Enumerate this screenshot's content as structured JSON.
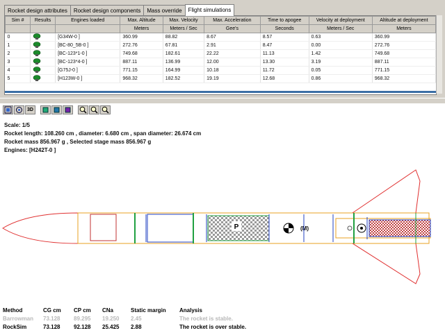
{
  "tabs": [
    {
      "label": "Rocket design attributes",
      "active": false
    },
    {
      "label": "Rocket design components",
      "active": false
    },
    {
      "label": "Mass override",
      "active": false
    },
    {
      "label": "Flight simulations",
      "active": true
    }
  ],
  "table": {
    "headers": [
      "Sim #",
      "Results",
      "Engines loaded",
      "Max. Altitude",
      "Max. Velocity",
      "Max. Acceleration",
      "Time to apogee",
      "Velocity at deployment",
      "Altitude at deployment"
    ],
    "units": [
      "",
      "",
      "",
      "Meters",
      "Meters / Sec",
      "Gee's",
      "Seconds",
      "Meters / Sec",
      "Meters"
    ],
    "rows": [
      [
        "0",
        "",
        "[G34W-0 ]",
        "360.99",
        "88.82",
        "8.67",
        "8.57",
        "0.63",
        "360.99"
      ],
      [
        "1",
        "",
        "[BC-80_5B-0 ]",
        "272.76",
        "67.81",
        "2.91",
        "8.47",
        "0.00",
        "272.76"
      ],
      [
        "2",
        "",
        "[BC-123*1-0 ]",
        "749.68",
        "182.61",
        "22.22",
        "11.13",
        "1.42",
        "749.68"
      ],
      [
        "3",
        "",
        "[BC-123*4-0 ]",
        "887.11",
        "136.99",
        "12.00",
        "13.30",
        "3.19",
        "887.11"
      ],
      [
        "4",
        "",
        "[G75J-0 ]",
        "771.15",
        "164.99",
        "10.18",
        "11.72",
        "0.05",
        "771.15"
      ],
      [
        "5",
        "",
        "[H123W-0 ]",
        "968.32",
        "182.52",
        "19.19",
        "12.68",
        "0.86",
        "968.32"
      ]
    ]
  },
  "toolbar": {
    "buttons": [
      {
        "name": "view-icon",
        "label": ""
      },
      {
        "name": "view2-icon",
        "label": ""
      },
      {
        "name": "3d-button",
        "label": "3D"
      },
      {
        "name": "engine-icon",
        "label": ""
      },
      {
        "name": "engine2-icon",
        "label": ""
      },
      {
        "name": "engine3-icon",
        "label": ""
      },
      {
        "name": "zoom-in-icon",
        "label": ""
      },
      {
        "name": "zoom-out-icon",
        "label": ""
      },
      {
        "name": "zoom-fit-icon",
        "label": ""
      }
    ]
  },
  "info": {
    "scale": "Scale: 1/5",
    "length": "Rocket length: 108.260  cm , diameter: 6.680  cm , span diameter: 26.674  cm",
    "mass": "Rocket mass 856.967 g , Selected stage mass 856.967 g",
    "engines": "Engines: [H242T-0  ]"
  },
  "rocket_labels": {
    "payload": "P",
    "mass": "(M)"
  },
  "results": {
    "headers": [
      "Method",
      "CG cm",
      "CP cm",
      "CNa",
      "Static margin",
      "Analysis"
    ],
    "rows": [
      [
        "Barrowman",
        "73.128",
        "89.295",
        "19.250",
        "2.45",
        "The rocket is stable."
      ],
      [
        "RockSim",
        "73.128",
        "92.128",
        "25.425",
        "2.88",
        "The rocket is over stable."
      ]
    ]
  },
  "colors": {
    "panel": "#d4d0c8",
    "selection": "#3a6ea5",
    "nose": "#e03030",
    "body": "#e8a020",
    "tube": "#2040c0",
    "coupler": "#20a040"
  }
}
